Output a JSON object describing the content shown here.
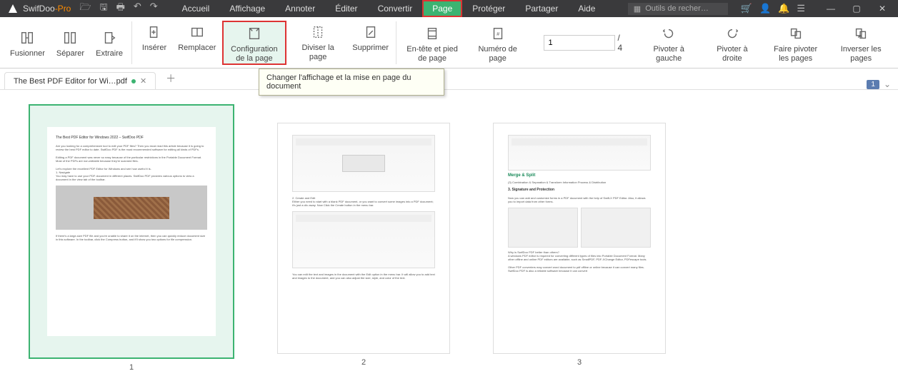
{
  "app": {
    "name_pre": "SwifDoo",
    "name_suf": "-Pro"
  },
  "menu": {
    "items": [
      "Accueil",
      "Affichage",
      "Annoter",
      "Éditer",
      "Convertir",
      "Page",
      "Protéger",
      "Partager",
      "Aide"
    ],
    "active_index": 5
  },
  "search": {
    "placeholder": "Outils de recher…"
  },
  "ribbon": {
    "merge": "Fusionner",
    "split": "Séparer",
    "extract": "Extraire",
    "insert": "Insérer",
    "replace": "Remplacer",
    "config": "Configuration de la page",
    "divide": "Diviser la page",
    "delete": "Supprimer",
    "header": "En-tête et pied de page",
    "number": "Numéro de page",
    "rot_left": "Pivoter à gauche",
    "rot_right": "Pivoter à droite",
    "rot_pages": "Faire pivoter les pages",
    "inv_pages": "Inverser les pages"
  },
  "pagebox": {
    "current": "1",
    "total": "/ 4"
  },
  "tooltip": {
    "text": "Changer l'affichage et la mise en page du document"
  },
  "tab": {
    "title": "The Best PDF Editor for Wi…pdf"
  },
  "viewer": {
    "page_badge": "1",
    "pages": [
      "1",
      "2",
      "3"
    ]
  },
  "page3": {
    "h1": "Merge & Split",
    "h2": "3. Signature and Protection"
  }
}
